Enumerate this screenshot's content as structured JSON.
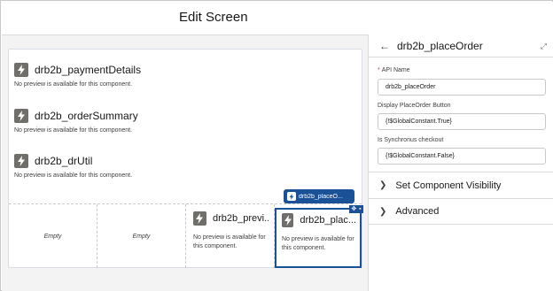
{
  "header": {
    "title": "Edit Screen"
  },
  "canvas": {
    "components": [
      {
        "title": "drb2b_paymentDetails",
        "note": "No preview is available for this component."
      },
      {
        "title": "drb2b_orderSummary",
        "note": "No preview is available for this component."
      },
      {
        "title": "drb2b_drUtil",
        "note": "No preview is available for this component."
      }
    ],
    "columns": [
      {
        "empty_label": "Empty"
      },
      {
        "empty_label": "Empty"
      },
      {
        "title": "drb2b_previ...",
        "note": "No preview is available for this component."
      },
      {
        "title": "drb2b_plac...",
        "note": "No preview is available for this component."
      }
    ],
    "selected_tag": "drb2b_placeO..."
  },
  "panel": {
    "title": "drb2b_placeOrder",
    "fields": [
      {
        "label": "API Name",
        "required_mark": "*",
        "value": "drb2b_placeOrder"
      },
      {
        "label": "Display PlaceOrder Button",
        "value": "{!$GlobalConstant.True}"
      },
      {
        "label": "Is Synchronus checkout",
        "value": "{!$GlobalConstant.False}"
      }
    ],
    "sections": [
      {
        "label": "Set Component Visibility"
      },
      {
        "label": "Advanced"
      }
    ]
  },
  "colors": {
    "accent": "#1b5297",
    "required": "#c23934",
    "icon_bg": "#706e6b"
  }
}
